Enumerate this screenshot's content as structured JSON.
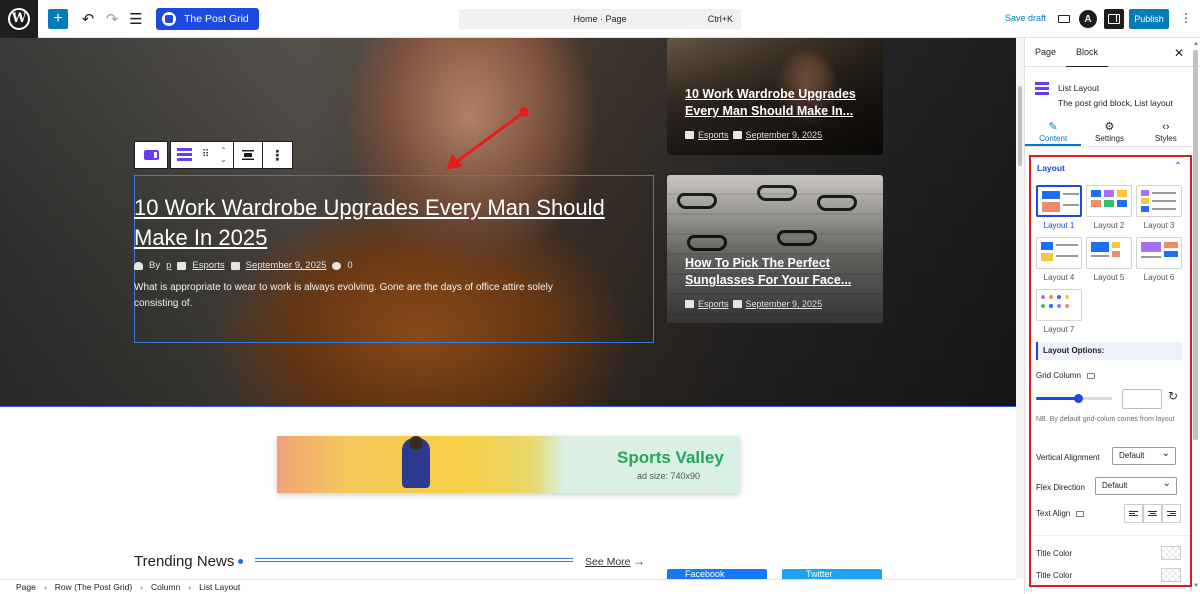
{
  "topbar": {
    "plus_label": "+",
    "plugin_button": "The Post Grid",
    "command": {
      "title": "Home · Page",
      "shortcut": "Ctrl+K"
    },
    "save_draft": "Save draft",
    "publish": "Publish",
    "astra_letter": "A"
  },
  "hero": {
    "title": "10 Work Wardrobe Upgrades Every Man Should Make In 2025",
    "meta": {
      "by": "By",
      "author": "p",
      "category": "Esports",
      "date": "September 9, 2025",
      "comments": "0"
    },
    "excerpt": "What is appropriate to wear to work is always evolving. Gone are the days of office attire solely consisting of."
  },
  "side_posts": [
    {
      "title": "10 Work Wardrobe Upgrades Every Man Should Make In...",
      "category": "Esports",
      "date": "September 9, 2025"
    },
    {
      "title": "How To Pick The Perfect Sunglasses For Your Face...",
      "category": "Esports",
      "date": "September 9, 2025"
    }
  ],
  "ad": {
    "title": "Sports Valley",
    "size": "ad size: 740x90"
  },
  "trending": {
    "title": "Trending News",
    "see_more": "See More"
  },
  "social": {
    "facebook": "Facebook",
    "twitter": "Twitter"
  },
  "breadcrumbs": [
    "Page",
    "Row (The Post Grid)",
    "Column",
    "List Layout"
  ],
  "sidebar": {
    "tabs": [
      "Page",
      "Block"
    ],
    "active_tab": "Block",
    "block_name": "List Layout",
    "block_desc": "The post grid block, List layout",
    "sub_tabs": [
      {
        "label": "Content",
        "icon": "pencil-icon"
      },
      {
        "label": "Settings",
        "icon": "gear-icon"
      },
      {
        "label": "Styles",
        "icon": "code-icon"
      }
    ],
    "layout_section": "Layout",
    "layouts": [
      "Layout 1",
      "Layout 2",
      "Layout 3",
      "Layout 4",
      "Layout 5",
      "Layout 6",
      "Layout 7"
    ],
    "selected_layout": "Layout 1",
    "layout_options": "Layout Options:",
    "grid_column": "Grid Column",
    "grid_note": "NB. By default grid-colum comes from layout",
    "vertical_alignment": {
      "label": "Vertical Alignment",
      "value": "Default"
    },
    "flex_direction": {
      "label": "Flex Direction",
      "value": "Default"
    },
    "text_align": "Text Align",
    "title_color_1": "Title Color",
    "title_color_2": "Title Color"
  },
  "colors": {
    "accent": "#007cba",
    "plugin": "#1d49e0",
    "highlight_border": "#e0191f",
    "arrow": "#e81c1c"
  }
}
